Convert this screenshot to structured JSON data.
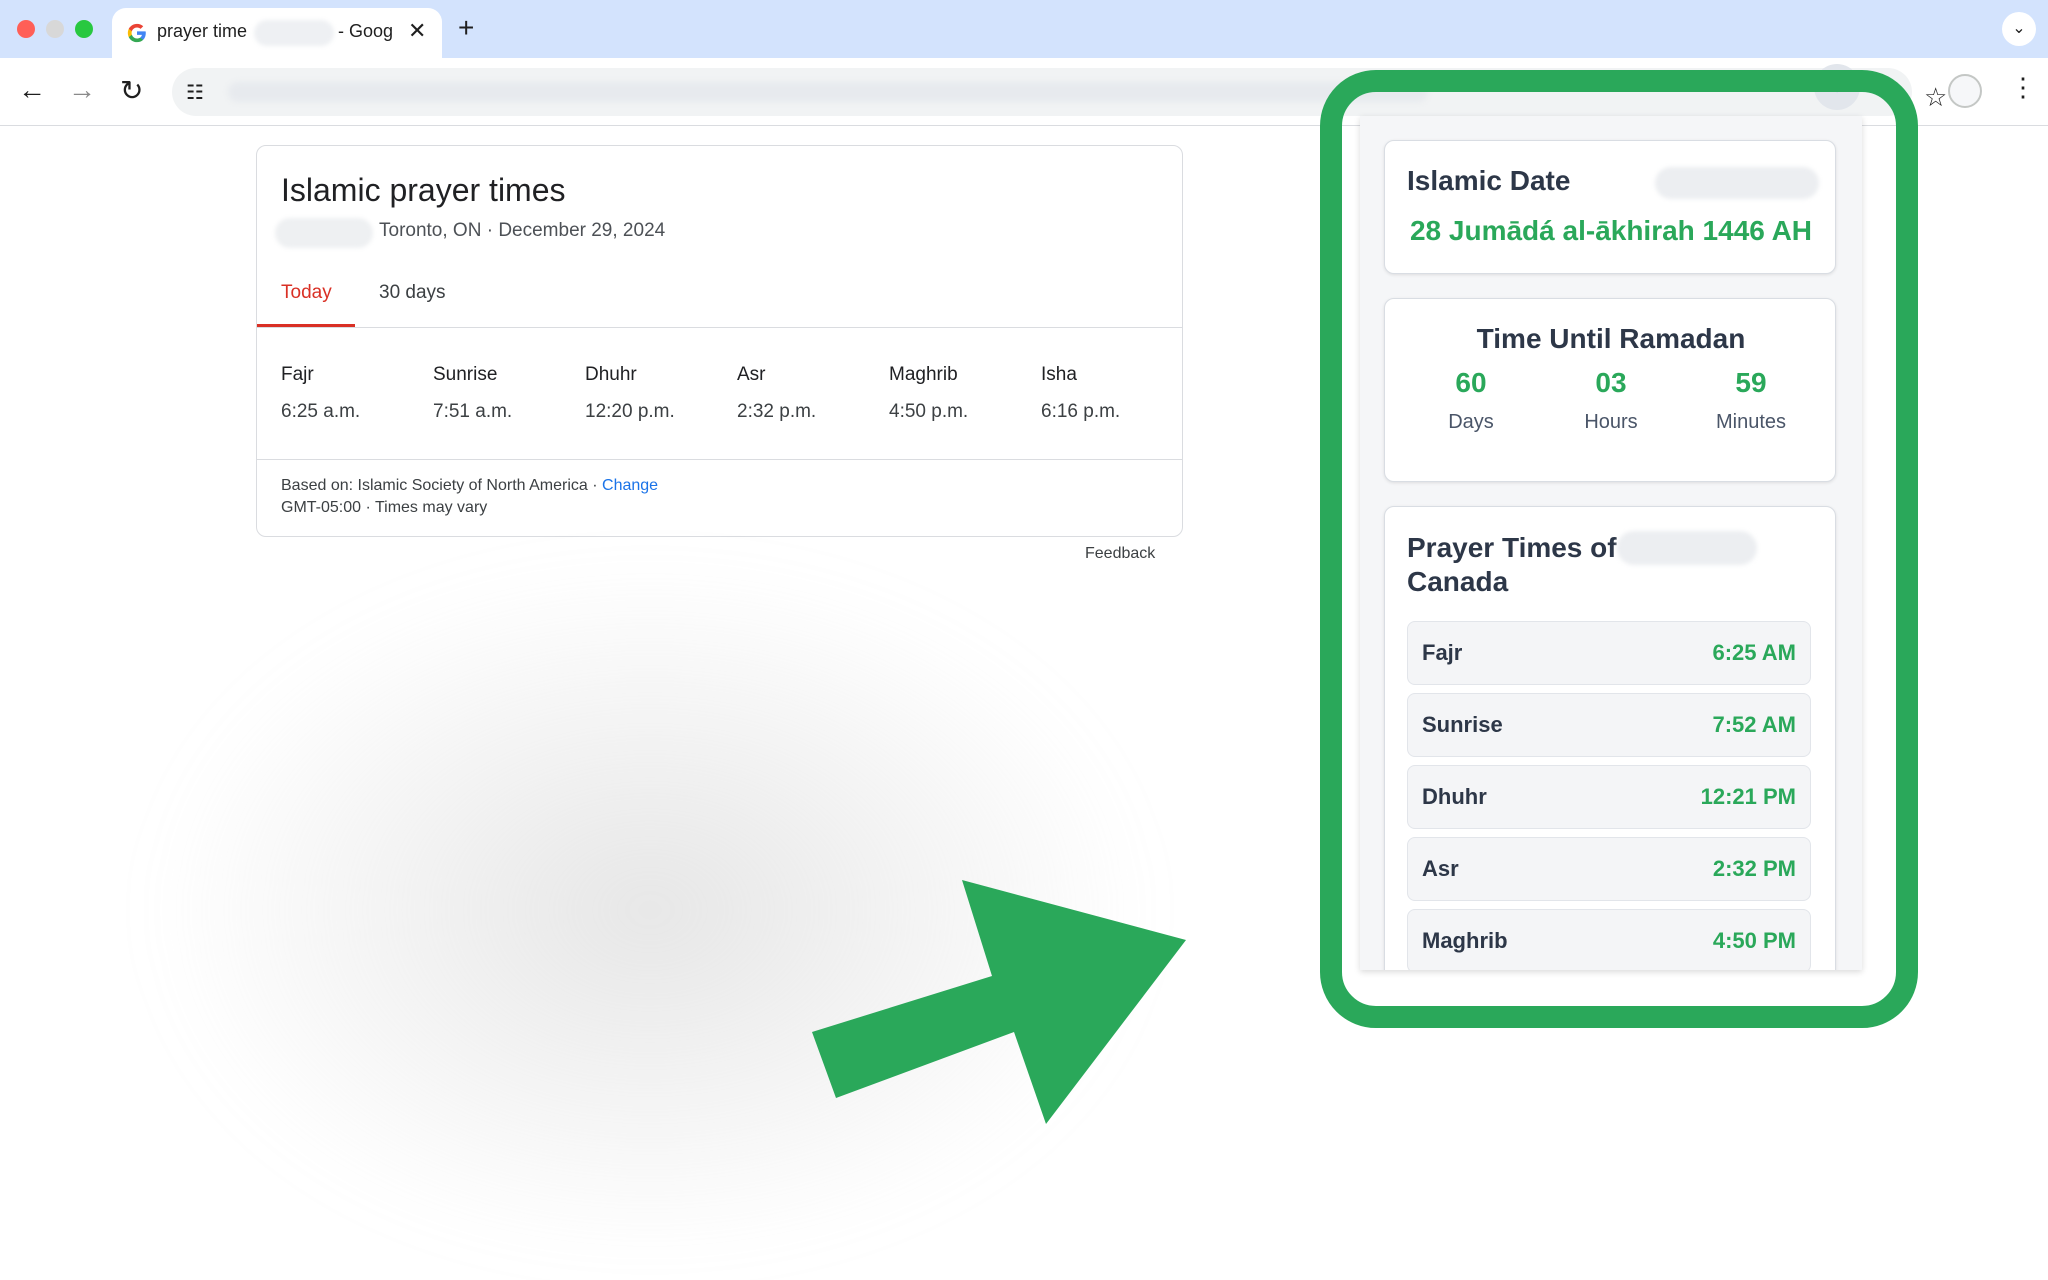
{
  "tab": {
    "title_start": "prayer time",
    "title_end": "- Goog"
  },
  "google": {
    "title": "Islamic prayer times",
    "location_date": "Toronto, ON · December 29, 2024",
    "tabs": [
      "Today",
      "30 days"
    ],
    "prayers": [
      {
        "name": "Fajr",
        "time": "6:25 a.m."
      },
      {
        "name": "Sunrise",
        "time": "7:51 a.m."
      },
      {
        "name": "Dhuhr",
        "time": "12:20 p.m."
      },
      {
        "name": "Asr",
        "time": "2:32 p.m."
      },
      {
        "name": "Maghrib",
        "time": "4:50 p.m."
      },
      {
        "name": "Isha",
        "time": "6:16 p.m."
      }
    ],
    "based_on": "Based on: Islamic Society of North America · ",
    "change_link": "Change",
    "gmt_note": "GMT-05:00 · Times may vary",
    "feedback": "Feedback"
  },
  "extension": {
    "islamic_date_label": "Islamic Date",
    "islamic_date_value": "28 Jumādá al-ākhirah 1446 AH",
    "ramadan_title": "Time Until Ramadan",
    "countdown": [
      {
        "value": "60",
        "unit": "Days"
      },
      {
        "value": "03",
        "unit": "Hours"
      },
      {
        "value": "59",
        "unit": "Minutes"
      }
    ],
    "prayer_times_title_line1": "Prayer Times of",
    "prayer_times_title_line2": "Canada",
    "prayers": [
      {
        "name": "Fajr",
        "time": "6:25 AM"
      },
      {
        "name": "Sunrise",
        "time": "7:52 AM"
      },
      {
        "name": "Dhuhr",
        "time": "12:21 PM"
      },
      {
        "name": "Asr",
        "time": "2:32 PM"
      },
      {
        "name": "Maghrib",
        "time": "4:50 PM"
      }
    ]
  },
  "colors": {
    "accent_green": "#2aa85a",
    "google_red": "#d93025",
    "link_blue": "#1a73e8"
  },
  "icons": [
    "back-arrow-icon",
    "forward-arrow-icon",
    "reload-icon",
    "site-settings-icon",
    "bookmark-star-icon",
    "extension-puzzle-icon",
    "profile-avatar",
    "more-menu-icon",
    "close-icon",
    "plus-icon",
    "chevron-down-icon",
    "google-logo-icon"
  ]
}
